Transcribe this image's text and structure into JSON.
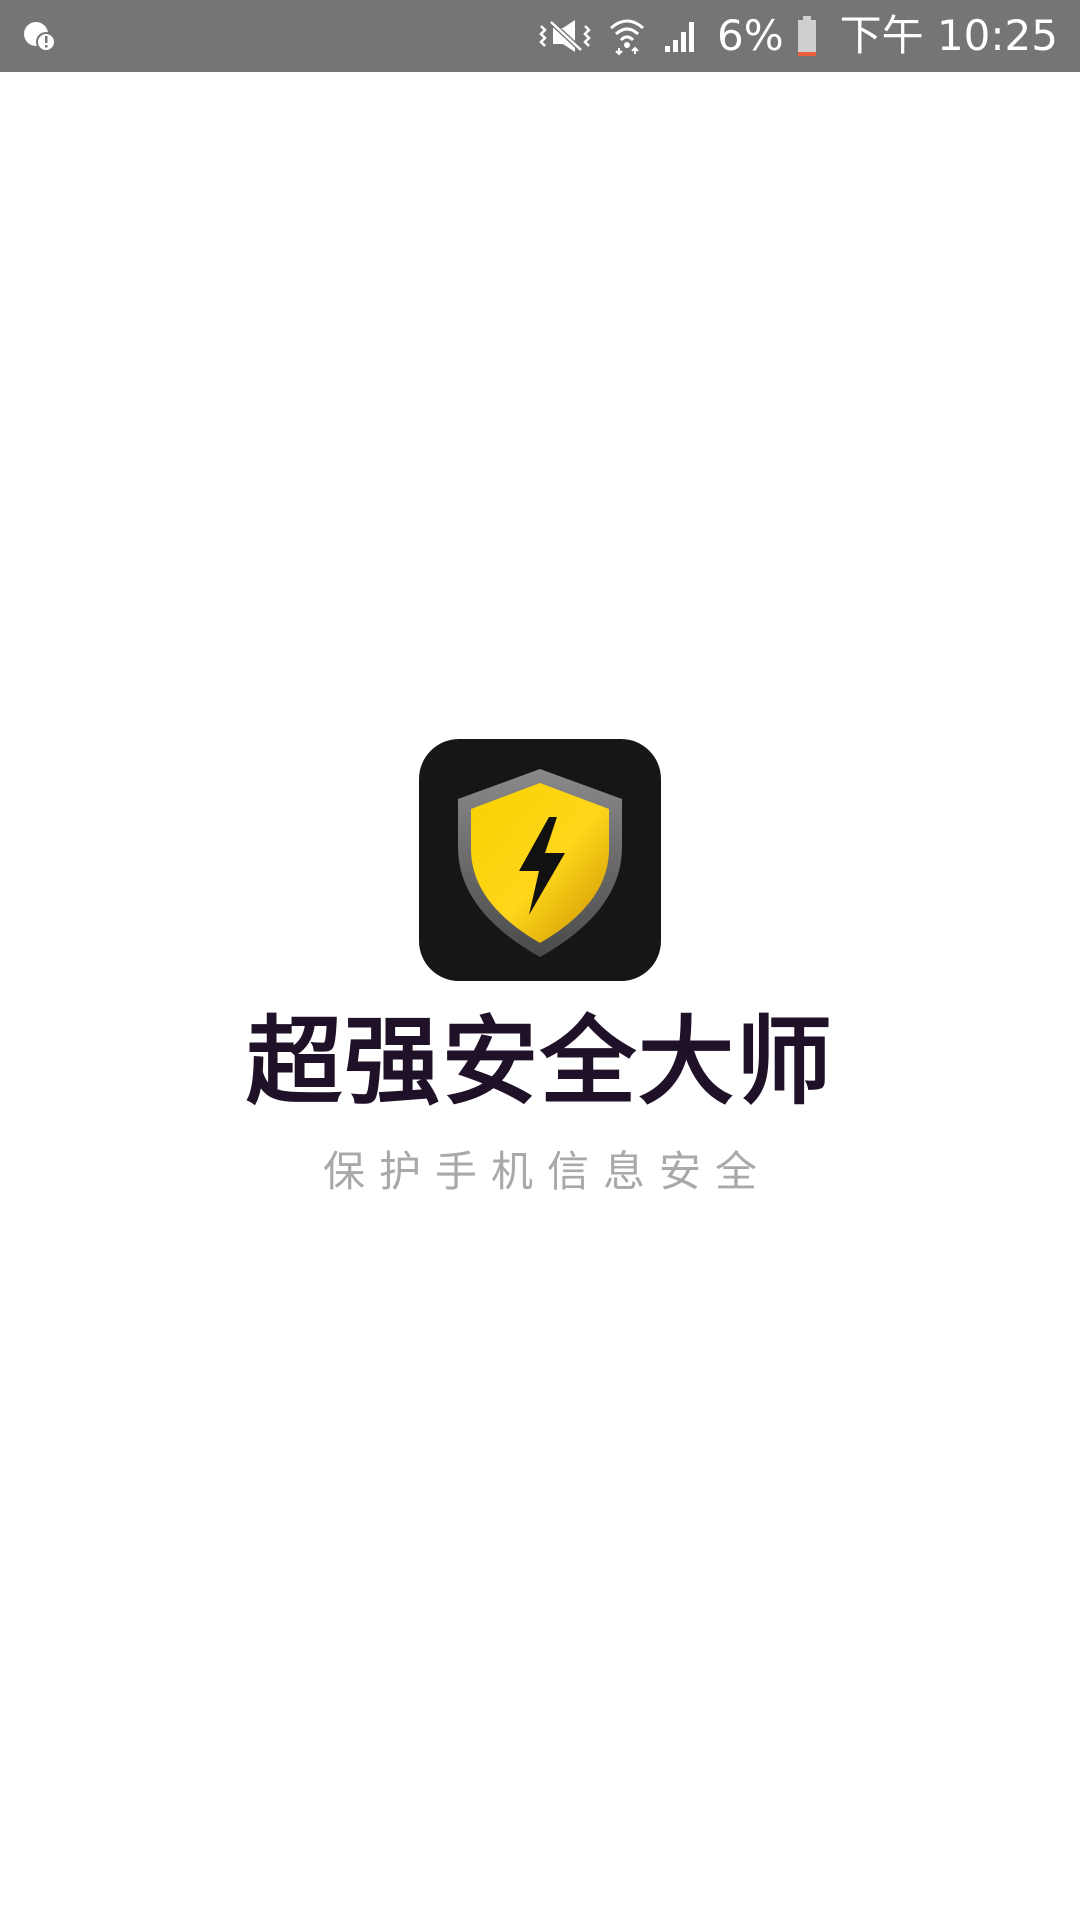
{
  "status_bar": {
    "notification_icon": "notification-alert-icon",
    "icons": [
      "vibrate-mute-icon",
      "wifi-icon",
      "cellular-signal-icon",
      "battery-low-icon"
    ],
    "battery_percent": "6%",
    "time": "下午 10:25",
    "background_color": "#757575"
  },
  "splash": {
    "logo_icon": "shield-lightning-icon",
    "app_name": "超强安全大师",
    "tagline": "保护手机信息安全",
    "colors": {
      "logo_background": "#161616",
      "shield_gold": "#f2c500",
      "shield_rim": "#6e6e6e",
      "title": "#1f1128",
      "tagline": "#a9a9a9"
    }
  }
}
